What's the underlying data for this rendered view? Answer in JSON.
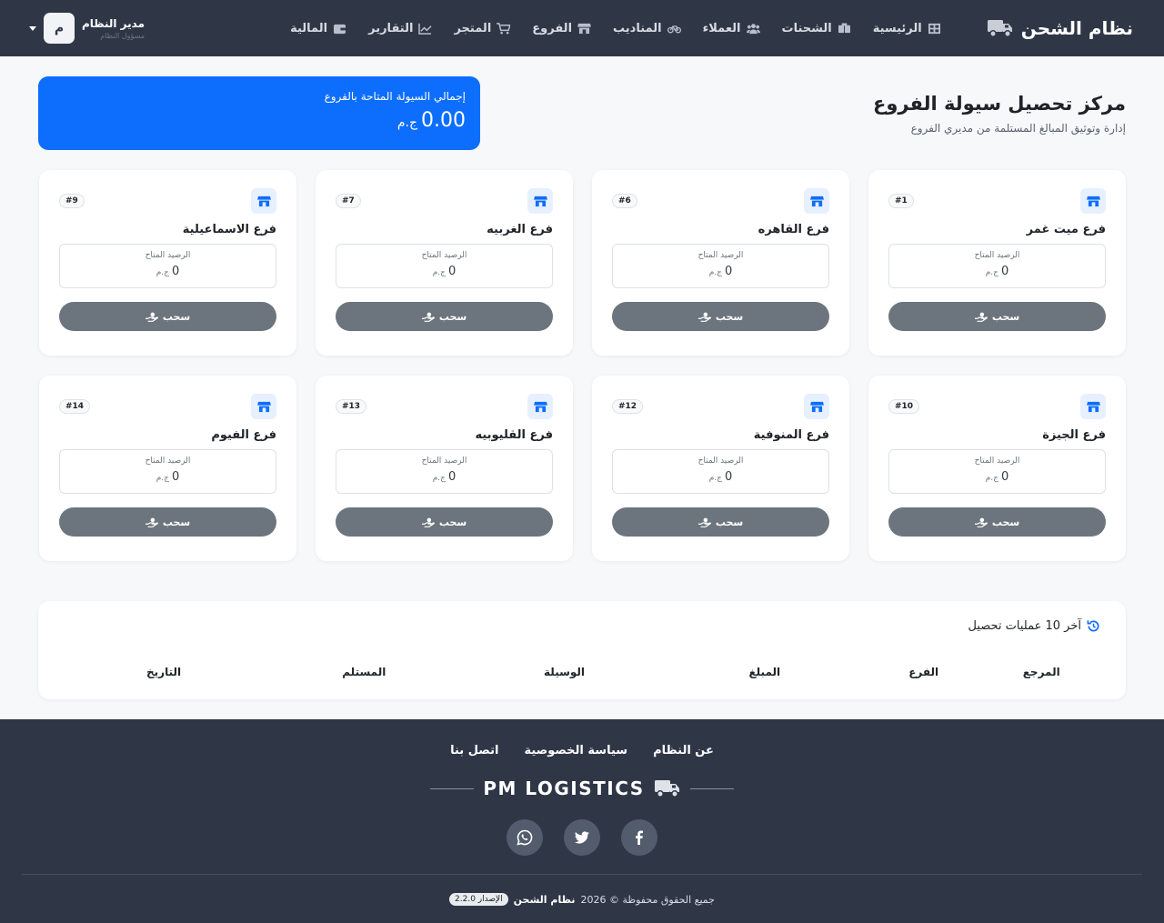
{
  "navbar": {
    "brand": "نظام الشحن",
    "links": [
      {
        "label": "الرئيسية",
        "icon": "grid-icon"
      },
      {
        "label": "الشحنات",
        "icon": "boxes-icon"
      },
      {
        "label": "العملاء",
        "icon": "users-icon"
      },
      {
        "label": "المناديب",
        "icon": "bicycle-icon"
      },
      {
        "label": "الفروع",
        "icon": "store-icon"
      },
      {
        "label": "المتجر",
        "icon": "cart-icon"
      },
      {
        "label": "التقارير",
        "icon": "chart-line-icon"
      },
      {
        "label": "المالية",
        "icon": "wallet-icon"
      }
    ],
    "user": {
      "name": "مدير النظام",
      "role": "مسؤول النظام",
      "initial": "م"
    }
  },
  "page": {
    "title": "مركز تحصيل سيولة الفروع",
    "subtitle": "إدارة وتوثيق المبالغ المستلمة من مديري الفروع"
  },
  "total": {
    "label": "إجمالي السيولة المتاحة بالفروع",
    "value": "0.00",
    "currency": "ج.م"
  },
  "branches": [
    {
      "name": "فرع ميت غمر",
      "id": "#1",
      "balance_label": "الرصيد المتاح",
      "balance": "0",
      "currency": "ج.م",
      "button": "سحب"
    },
    {
      "name": "فرع القاهره",
      "id": "#6",
      "balance_label": "الرصيد المتاح",
      "balance": "0",
      "currency": "ج.م",
      "button": "سحب"
    },
    {
      "name": "فرع الغربيه",
      "id": "#7",
      "balance_label": "الرصيد المتاح",
      "balance": "0",
      "currency": "ج.م",
      "button": "سحب"
    },
    {
      "name": "فرع الاسماعيلية",
      "id": "#9",
      "balance_label": "الرصيد المتاح",
      "balance": "0",
      "currency": "ج.م",
      "button": "سحب"
    },
    {
      "name": "فرع الجيزة",
      "id": "#10",
      "balance_label": "الرصيد المتاح",
      "balance": "0",
      "currency": "ج.م",
      "button": "سحب"
    },
    {
      "name": "فرع المنوفية",
      "id": "#12",
      "balance_label": "الرصيد المتاح",
      "balance": "0",
      "currency": "ج.م",
      "button": "سحب"
    },
    {
      "name": "فرع القليوبيه",
      "id": "#13",
      "balance_label": "الرصيد المتاح",
      "balance": "0",
      "currency": "ج.م",
      "button": "سحب"
    },
    {
      "name": "فرع الفيوم",
      "id": "#14",
      "balance_label": "الرصيد المتاح",
      "balance": "0",
      "currency": "ج.م",
      "button": "سحب"
    }
  ],
  "transactions": {
    "title": "آخر 10 عمليات تحصيل",
    "columns": [
      "المرجع",
      "الفرع",
      "المبلغ",
      "الوسيلة",
      "المستلم",
      "التاريخ"
    ]
  },
  "footer": {
    "links": [
      "عن النظام",
      "سياسة الخصوصية",
      "اتصل بنا"
    ],
    "brand": "PM LOGISTICS",
    "socials": [
      "facebook-icon",
      "twitter-icon",
      "whatsapp-icon"
    ],
    "copyright_prefix": "جميع الحقوق محفوظة © 2026",
    "copyright_name": "نظام الشحن",
    "version": "الإصدار 2.2.0"
  },
  "colors": {
    "primary": "#0d6efd",
    "navbar": "#2f3747",
    "button": "#6c757d"
  }
}
